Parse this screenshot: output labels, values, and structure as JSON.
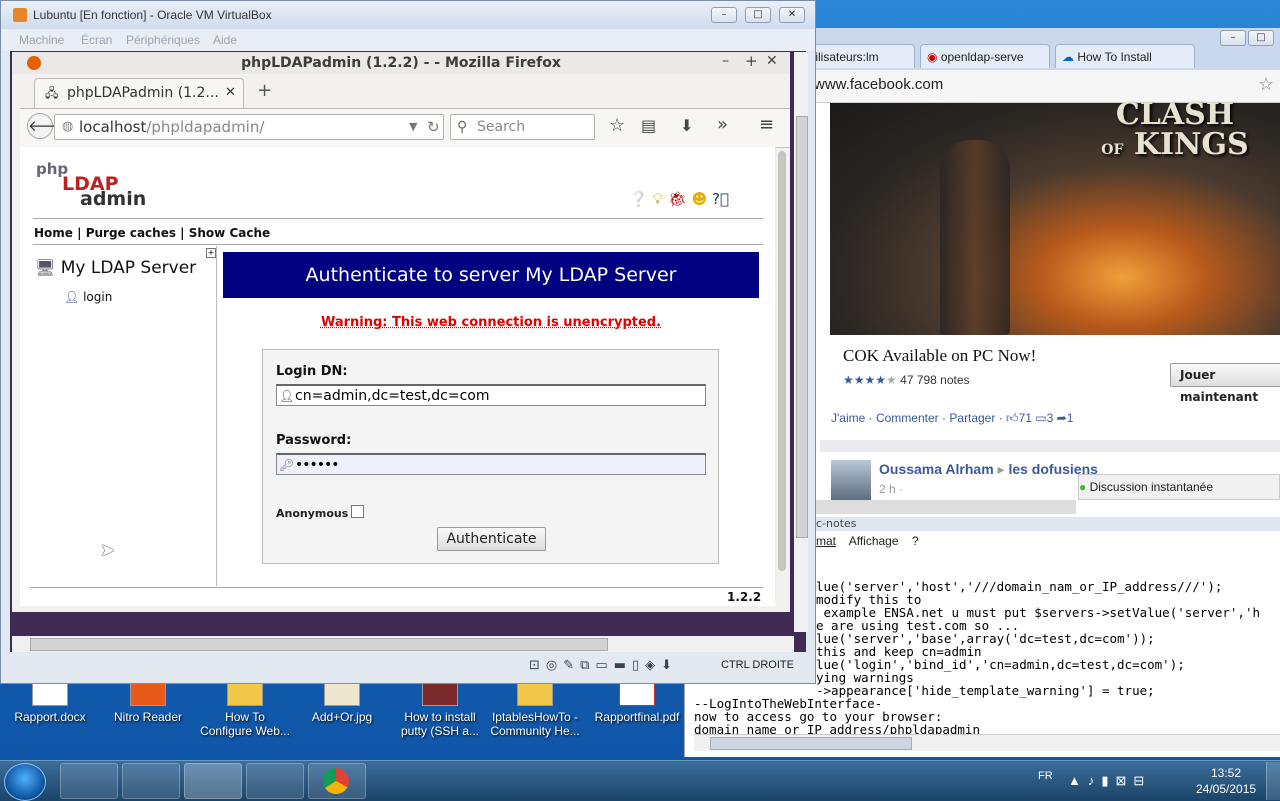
{
  "vbox": {
    "title": "Lubuntu [En fonction] - Oracle VM VirtualBox",
    "menu": [
      "Machine",
      "Écran",
      "Périphériques",
      "Aide"
    ],
    "host_key": "CTRL DROITE"
  },
  "firefox": {
    "title": "phpLDAPadmin (1.2.2) - - Mozilla Firefox",
    "tab_label": "phpLDAPadmin (1.2...",
    "url_host": "localhost",
    "url_path": "/phpldapadmin/",
    "search_placeholder": "Search"
  },
  "pla": {
    "logo": [
      "php",
      "LDAP",
      "admin"
    ],
    "links": [
      "Home",
      "Purge caches",
      "Show Cache"
    ],
    "server_name": "My LDAP Server",
    "tree_login": "login",
    "header": "Authenticate to server My LDAP Server",
    "warning": "Warning: This web connection is unencrypted.",
    "login_dn_label": "Login DN:",
    "login_dn_value": "cn=admin,dc=test,dc=com",
    "password_label": "Password:",
    "password_value": "••••••",
    "anonymous_label": "Anonymous",
    "auth_button": "Authenticate",
    "version": "1.2.2"
  },
  "chrome": {
    "tabs": [
      "tilisateurs:lm",
      "openldap-serve",
      "How To Install"
    ],
    "url": "www.facebook.com",
    "ad_title": "COK Available on PC Now!",
    "ad_notes": "47 798 notes",
    "ad_button": "Jouer maintenant",
    "actions": "J'aime · Commenter · Partager ·",
    "likes": "71",
    "comments": "3",
    "shares": "1",
    "post_author": "Oussama Alrham",
    "post_group": "les dofusiens",
    "post_time": "2 h ·",
    "chat_label": "Discussion instantanée",
    "game_logo": [
      "CLASH",
      "OF",
      "KINGS"
    ]
  },
  "editor": {
    "title": "c-notes",
    "menu": [
      "mat",
      "Affichage",
      "?"
    ],
    "lines": [
      "lue('server','host','///domain_nam_or_IP_address///');",
      "modify this to",
      " example ENSA.net u must put $servers->setValue('server','h",
      "e are using test.com so ...",
      "lue('server','base',array('dc=test,dc=com'));",
      "this and keep cn=admin",
      "lue('login','bind_id','cn=admin,dc=test,dc=com');",
      "ying warnings",
      "->appearance['hide_template_warning'] = true;",
      "--LogIntoTheWebInterface-",
      "now to access go to your browser:",
      "domain_name_or_IP_address/phpldapadmin"
    ]
  },
  "desktop_icons": [
    {
      "label": "Rapport.docx"
    },
    {
      "label": "Nitro Reader"
    },
    {
      "label": "How To Configure Web..."
    },
    {
      "label": "Add+Or.jpg"
    },
    {
      "label": "How to install putty (SSH a..."
    },
    {
      "label": "IptablesHowTo - Community He..."
    },
    {
      "label": "Rapportfinal.pdf"
    }
  ],
  "tray": {
    "lang": "FR",
    "time": "13:52",
    "date": "24/05/2015"
  },
  "colors": {
    "pla_header_bg": "#000080",
    "warning_red": "#e00000",
    "desktop_blue": "#1a63b8"
  }
}
